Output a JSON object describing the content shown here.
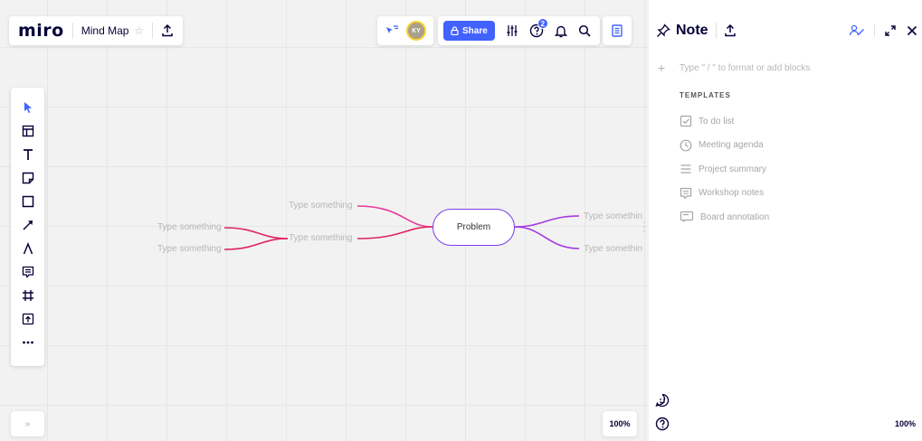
{
  "app": {
    "logo": "miro",
    "board_name": "Mind Map"
  },
  "header": {
    "share_label": "Share",
    "avatar_initials": "KY",
    "notification_count": "2"
  },
  "toolbar": {
    "tools": [
      {
        "name": "select-tool",
        "icon": "cursor-icon"
      },
      {
        "name": "templates-tool",
        "icon": "template-icon"
      },
      {
        "name": "text-tool",
        "icon": "text-icon"
      },
      {
        "name": "sticky-note-tool",
        "icon": "sticky-note-icon"
      },
      {
        "name": "shape-tool",
        "icon": "square-icon"
      },
      {
        "name": "connection-line-tool",
        "icon": "arrow-icon"
      },
      {
        "name": "pen-tool",
        "icon": "pen-icon"
      },
      {
        "name": "comment-tool",
        "icon": "comment-icon"
      },
      {
        "name": "frame-tool",
        "icon": "frame-icon"
      },
      {
        "name": "upload-tool",
        "icon": "upload-icon"
      },
      {
        "name": "more-tools",
        "icon": "more-icon"
      }
    ],
    "expand_label": "»"
  },
  "mindmap": {
    "center": "Problem",
    "left_nodes": [
      "Type something",
      "Type something"
    ],
    "left_children": [
      "Type something",
      "Type something"
    ],
    "right_nodes": [
      "Type somethin",
      "Type somethin"
    ],
    "colors": {
      "pink": "#e8399b",
      "red": "#e0245e",
      "purple": "#a23ae0",
      "node_border": "#7a3cf0"
    }
  },
  "zoom": {
    "board": "100%",
    "notes": "100%"
  },
  "notes": {
    "title": "Note",
    "placeholder": "Type \" / \" to format or add blocks",
    "templates_label": "TEMPLATES",
    "templates": [
      {
        "label": "To do list",
        "icon": "checkbox-icon"
      },
      {
        "label": "Meeting agenda",
        "icon": "clock-icon"
      },
      {
        "label": "Project summary",
        "icon": "lines-icon"
      },
      {
        "label": "Workshop notes",
        "icon": "notes-icon"
      },
      {
        "label": "Board annotation",
        "icon": "annotation-icon"
      }
    ]
  },
  "colors": {
    "accent": "#4262ff",
    "brand": "#050038"
  }
}
